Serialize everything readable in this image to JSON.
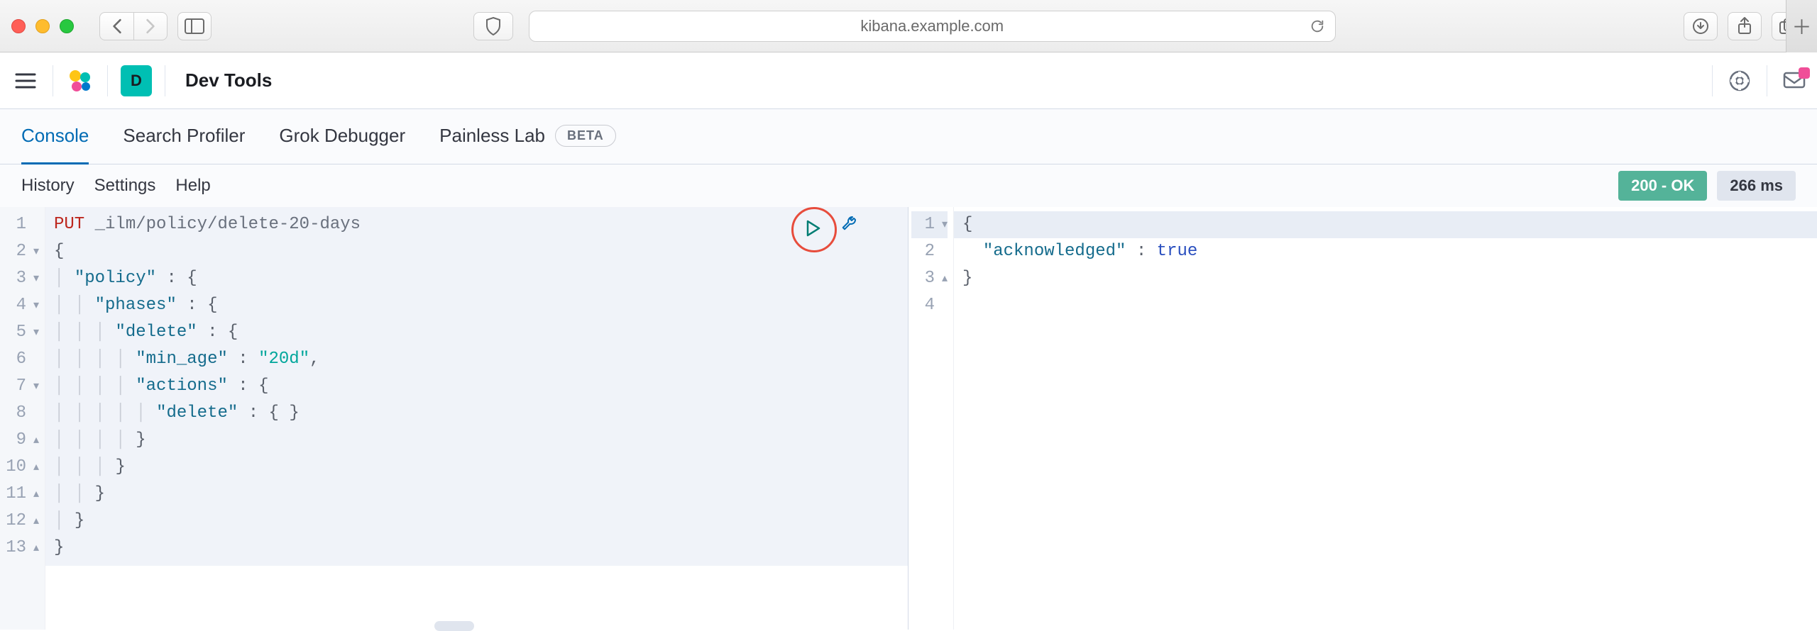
{
  "browser": {
    "url": "kibana.example.com"
  },
  "header": {
    "space_letter": "D",
    "breadcrumb": "Dev Tools"
  },
  "tabs": [
    {
      "label": "Console",
      "active": true,
      "badge": null
    },
    {
      "label": "Search Profiler",
      "active": false,
      "badge": null
    },
    {
      "label": "Grok Debugger",
      "active": false,
      "badge": null
    },
    {
      "label": "Painless Lab",
      "active": false,
      "badge": "BETA"
    }
  ],
  "subbar": {
    "links": [
      "History",
      "Settings",
      "Help"
    ],
    "status_code": "200 - OK",
    "latency": "266 ms"
  },
  "request": {
    "method": "PUT",
    "path": "_ilm/policy/delete-20-days",
    "lines": [
      "{",
      "  \"policy\" : {",
      "    \"phases\" : {",
      "      \"delete\" : {",
      "        \"min_age\" : \"20d\",",
      "        \"actions\" : {",
      "          \"delete\" : { }",
      "        }",
      "      }",
      "    }",
      "  }",
      "}"
    ],
    "gutter": [
      "1",
      "2",
      "3",
      "4",
      "5",
      "6",
      "7",
      "8",
      "9",
      "10",
      "11",
      "12",
      "13"
    ]
  },
  "response": {
    "gutter": [
      "1",
      "2",
      "3",
      "4"
    ],
    "lines": [
      "{",
      "  \"acknowledged\" : true",
      "}",
      ""
    ]
  }
}
